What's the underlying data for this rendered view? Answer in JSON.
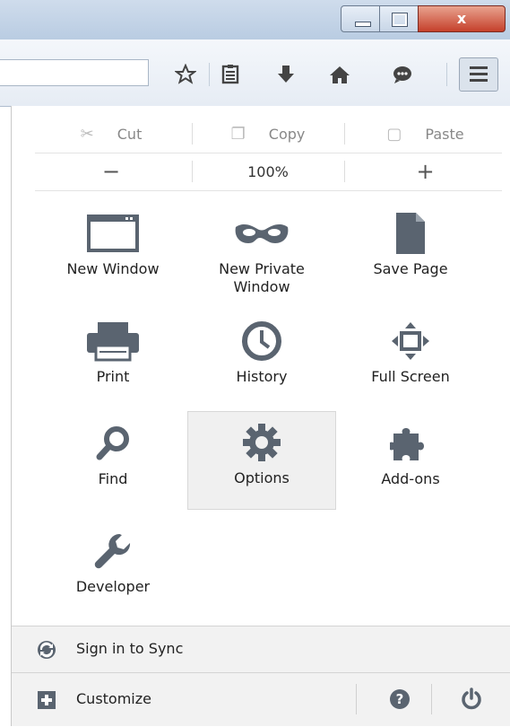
{
  "window_controls": {
    "close_glyph": "x"
  },
  "toolbar": {
    "icons": [
      "star-icon",
      "reading-list-icon",
      "download-icon",
      "home-icon",
      "chat-icon",
      "menu-icon"
    ]
  },
  "edit": {
    "cut": "Cut",
    "copy": "Copy",
    "paste": "Paste"
  },
  "zoom": {
    "minus": "−",
    "value": "100%",
    "plus": "+"
  },
  "grid": {
    "new_window": "New Window",
    "new_private_window_1": "New Private",
    "new_private_window_2": "Window",
    "save_page": "Save Page",
    "print": "Print",
    "history": "History",
    "full_screen": "Full Screen",
    "find": "Find",
    "options": "Options",
    "addons": "Add-ons",
    "developer": "Developer"
  },
  "footer": {
    "sync": "Sign in to Sync",
    "customize": "Customize"
  },
  "colors": {
    "icon_gray": "#5a6470",
    "panel_footer": "#f2f2f2",
    "selected_bg": "#f0f0f0"
  }
}
